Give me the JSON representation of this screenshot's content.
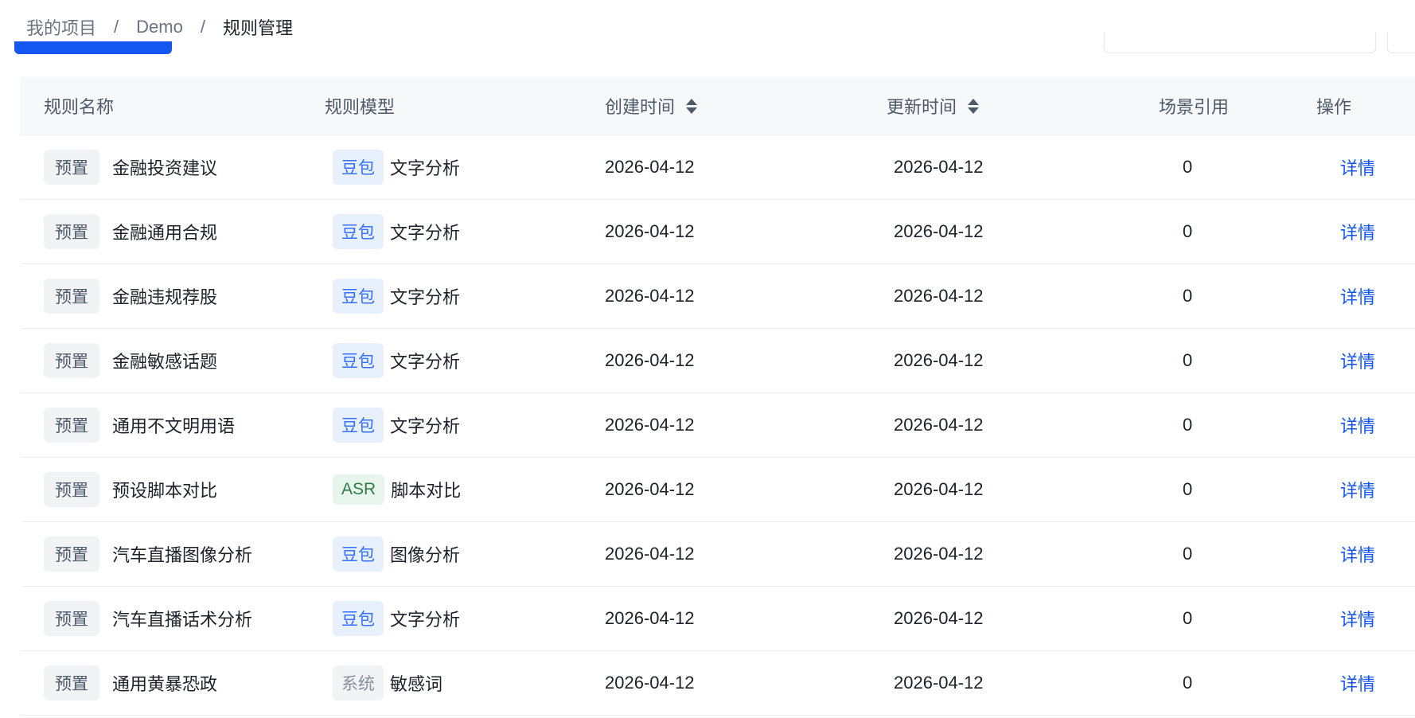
{
  "breadcrumb": {
    "items": [
      "我的项目",
      "Demo",
      "规则管理"
    ],
    "separator": "/"
  },
  "table": {
    "headers": {
      "name": "规则名称",
      "model": "规则模型",
      "created": "创建时间",
      "updated": "更新时间",
      "refs": "场景引用",
      "ops": "操作"
    },
    "rows": [
      {
        "tag": "预置",
        "name": "金融投资建议",
        "model_tag": "豆包",
        "model_tag_color": "blue",
        "model": "文字分析",
        "created": "2026-04-12",
        "updated": "2026-04-12",
        "refs": "0",
        "op": "详情"
      },
      {
        "tag": "预置",
        "name": "金融通用合规",
        "model_tag": "豆包",
        "model_tag_color": "blue",
        "model": "文字分析",
        "created": "2026-04-12",
        "updated": "2026-04-12",
        "refs": "0",
        "op": "详情"
      },
      {
        "tag": "预置",
        "name": "金融违规荐股",
        "model_tag": "豆包",
        "model_tag_color": "blue",
        "model": "文字分析",
        "created": "2026-04-12",
        "updated": "2026-04-12",
        "refs": "0",
        "op": "详情"
      },
      {
        "tag": "预置",
        "name": "金融敏感话题",
        "model_tag": "豆包",
        "model_tag_color": "blue",
        "model": "文字分析",
        "created": "2026-04-12",
        "updated": "2026-04-12",
        "refs": "0",
        "op": "详情"
      },
      {
        "tag": "预置",
        "name": "通用不文明用语",
        "model_tag": "豆包",
        "model_tag_color": "blue",
        "model": "文字分析",
        "created": "2026-04-12",
        "updated": "2026-04-12",
        "refs": "0",
        "op": "详情"
      },
      {
        "tag": "预置",
        "name": "预设脚本对比",
        "model_tag": "ASR",
        "model_tag_color": "green",
        "model": "脚本对比",
        "created": "2026-04-12",
        "updated": "2026-04-12",
        "refs": "0",
        "op": "详情"
      },
      {
        "tag": "预置",
        "name": "汽车直播图像分析",
        "model_tag": "豆包",
        "model_tag_color": "blue",
        "model": "图像分析",
        "created": "2026-04-12",
        "updated": "2026-04-12",
        "refs": "0",
        "op": "详情"
      },
      {
        "tag": "预置",
        "name": "汽车直播话术分析",
        "model_tag": "豆包",
        "model_tag_color": "blue",
        "model": "文字分析",
        "created": "2026-04-12",
        "updated": "2026-04-12",
        "refs": "0",
        "op": "详情"
      },
      {
        "tag": "预置",
        "name": "通用黄暴恐政",
        "model_tag": "系统",
        "model_tag_color": "gray",
        "model": "敏感词",
        "created": "2026-04-12",
        "updated": "2026-04-12",
        "refs": "0",
        "op": "详情"
      }
    ]
  },
  "colors": {
    "accent": "#1456f0",
    "header_bg": "#f7f8fa",
    "tag_blue": "#3370ff",
    "tag_green": "#2f7d4a",
    "tag_gray": "#86909c"
  }
}
